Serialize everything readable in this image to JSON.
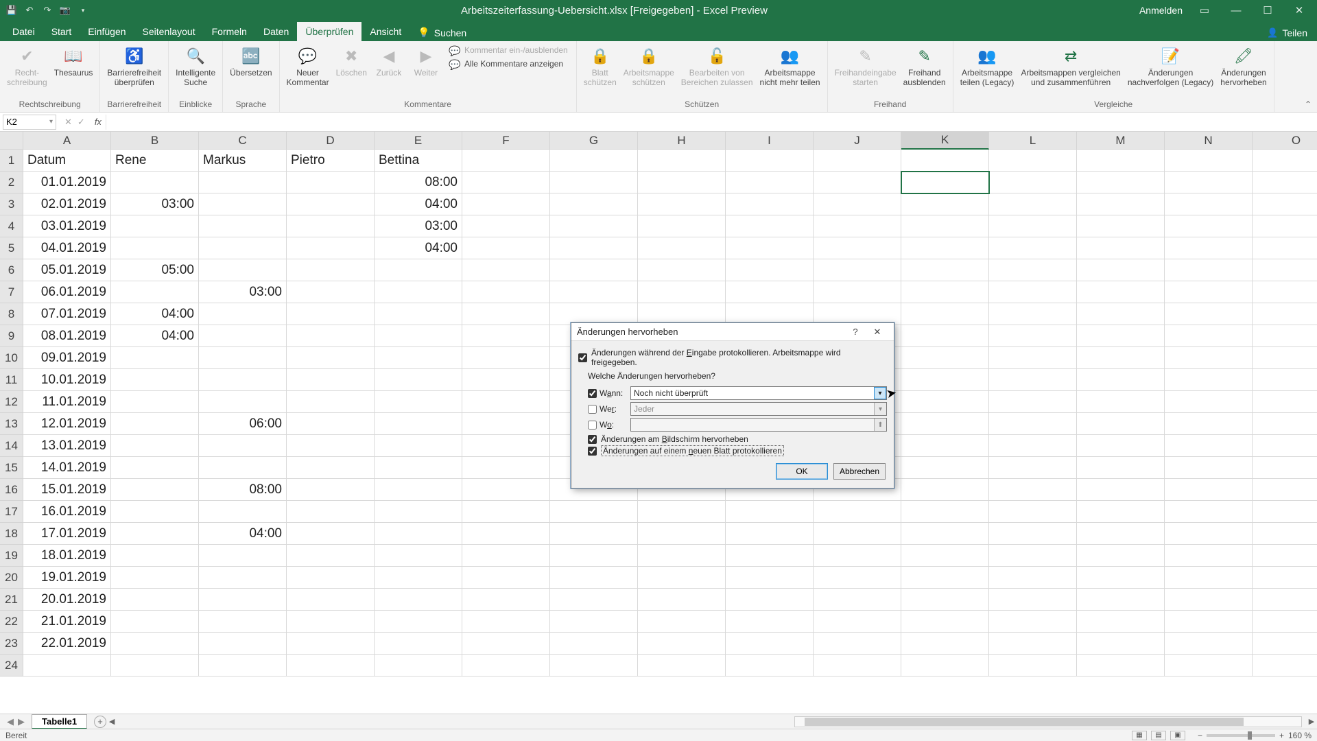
{
  "titlebar": {
    "doc_title": "Arbeitszeiterfassung-Uebersicht.xlsx  [Freigegeben] - Excel Preview",
    "sign_in": "Anmelden"
  },
  "tabs": {
    "items": [
      "Datei",
      "Start",
      "Einfügen",
      "Seitenlayout",
      "Formeln",
      "Daten",
      "Überprüfen",
      "Ansicht"
    ],
    "active_index": 6,
    "search": "Suchen",
    "share": "Teilen"
  },
  "ribbon": {
    "groups": [
      {
        "label": "Rechtschreibung",
        "items": [
          {
            "name": "rechtschreibung",
            "text": "Recht-\nschreibung",
            "icon": "✔",
            "disabled": true
          },
          {
            "name": "thesaurus",
            "text": "Thesaurus",
            "icon": "📖"
          }
        ]
      },
      {
        "label": "Barrierefreiheit",
        "items": [
          {
            "name": "barrierefreiheit",
            "text": "Barrierefreiheit\nüberprüfen",
            "icon": "♿"
          }
        ]
      },
      {
        "label": "Einblicke",
        "items": [
          {
            "name": "intelligente-suche",
            "text": "Intelligente\nSuche",
            "icon": "🔍"
          }
        ]
      },
      {
        "label": "Sprache",
        "items": [
          {
            "name": "uebersetzen",
            "text": "Übersetzen",
            "icon": "🔤"
          }
        ]
      },
      {
        "label": "Kommentare",
        "items": [
          {
            "name": "neuer-kommentar",
            "text": "Neuer\nKommentar",
            "icon": "💬"
          },
          {
            "name": "loeschen",
            "text": "Löschen",
            "icon": "✖",
            "disabled": true
          },
          {
            "name": "zurueck",
            "text": "Zurück",
            "icon": "◀",
            "disabled": true
          },
          {
            "name": "weiter",
            "text": "Weiter",
            "icon": "▶",
            "disabled": true
          }
        ],
        "stack": [
          {
            "name": "kommentar-ein-aus",
            "text": "Kommentar ein-/ausblenden",
            "icon": "💬",
            "disabled": true
          },
          {
            "name": "alle-kommentare",
            "text": "Alle Kommentare anzeigen",
            "icon": "💬"
          }
        ]
      },
      {
        "label": "Schützen",
        "items": [
          {
            "name": "blatt-schuetzen",
            "text": "Blatt\nschützen",
            "icon": "🔒",
            "disabled": true
          },
          {
            "name": "mappe-schuetzen",
            "text": "Arbeitsmappe\nschützen",
            "icon": "🔒",
            "disabled": true
          },
          {
            "name": "bearbeiten-bereiche",
            "text": "Bearbeiten von\nBereichen zulassen",
            "icon": "🔓",
            "disabled": true
          },
          {
            "name": "mappe-nicht-teilen",
            "text": "Arbeitsmappe\nnicht mehr teilen",
            "icon": "👥"
          }
        ]
      },
      {
        "label": "Freihand",
        "items": [
          {
            "name": "freihand-start",
            "text": "Freihandeingabe\nstarten",
            "icon": "✎",
            "disabled": true
          },
          {
            "name": "freihand-ausblenden",
            "text": "Freihand\nausblenden",
            "icon": "✎"
          }
        ]
      },
      {
        "label": "Vergleiche",
        "items": [
          {
            "name": "mappe-teilen",
            "text": "Arbeitsmappe\nteilen (Legacy)",
            "icon": "👥"
          },
          {
            "name": "mappen-vergleichen",
            "text": "Arbeitsmappen vergleichen\nund zusammenführen",
            "icon": "⇄"
          },
          {
            "name": "aenderungen-nachverfolgen",
            "text": "Änderungen\nnachverfolgen (Legacy)",
            "icon": "📝"
          },
          {
            "name": "aenderungen-hervorheben",
            "text": "Änderungen\nhervorheben",
            "icon": "🖍"
          }
        ]
      }
    ]
  },
  "namebox": "K2",
  "columns": [
    "A",
    "B",
    "C",
    "D",
    "E",
    "F",
    "G",
    "H",
    "I",
    "J",
    "K",
    "L",
    "M",
    "N",
    "O"
  ],
  "selected_col": "K",
  "selected_row": 2,
  "rows": [
    {
      "n": 1,
      "cells": [
        "Datum",
        "Rene",
        "Markus",
        "Pietro",
        "Bettina",
        "",
        "",
        "",
        "",
        "",
        "",
        "",
        "",
        ""
      ],
      "align": [
        "lt",
        "lt",
        "lt",
        "lt",
        "lt"
      ]
    },
    {
      "n": 2,
      "cells": [
        "01.01.2019",
        "",
        "",
        "",
        "08:00",
        "",
        "",
        "",
        "",
        "",
        "",
        "",
        "",
        ""
      ]
    },
    {
      "n": 3,
      "cells": [
        "02.01.2019",
        "03:00",
        "",
        "",
        "04:00",
        "",
        "",
        "",
        "",
        "",
        "",
        "",
        "",
        ""
      ]
    },
    {
      "n": 4,
      "cells": [
        "03.01.2019",
        "",
        "",
        "",
        "03:00",
        "",
        "",
        "",
        "",
        "",
        "",
        "",
        "",
        ""
      ]
    },
    {
      "n": 5,
      "cells": [
        "04.01.2019",
        "",
        "",
        "",
        "04:00",
        "",
        "",
        "",
        "",
        "",
        "",
        "",
        "",
        ""
      ]
    },
    {
      "n": 6,
      "cells": [
        "05.01.2019",
        "05:00",
        "",
        "",
        "",
        "",
        "",
        "",
        "",
        "",
        "",
        "",
        "",
        ""
      ]
    },
    {
      "n": 7,
      "cells": [
        "06.01.2019",
        "",
        "03:00",
        "",
        "",
        "",
        "",
        "",
        "",
        "",
        "",
        "",
        "",
        ""
      ]
    },
    {
      "n": 8,
      "cells": [
        "07.01.2019",
        "04:00",
        "",
        "",
        "",
        "",
        "",
        "",
        "",
        "",
        "",
        "",
        "",
        ""
      ]
    },
    {
      "n": 9,
      "cells": [
        "08.01.2019",
        "04:00",
        "",
        "",
        "",
        "",
        "",
        "",
        "",
        "",
        "",
        "",
        "",
        ""
      ]
    },
    {
      "n": 10,
      "cells": [
        "09.01.2019",
        "",
        "",
        "",
        "",
        "",
        "",
        "",
        "",
        "",
        "",
        "",
        "",
        ""
      ]
    },
    {
      "n": 11,
      "cells": [
        "10.01.2019",
        "",
        "",
        "",
        "",
        "",
        "",
        "",
        "",
        "",
        "",
        "",
        "",
        ""
      ]
    },
    {
      "n": 12,
      "cells": [
        "11.01.2019",
        "",
        "",
        "",
        "",
        "",
        "",
        "",
        "",
        "",
        "",
        "",
        "",
        ""
      ]
    },
    {
      "n": 13,
      "cells": [
        "12.01.2019",
        "",
        "06:00",
        "",
        "",
        "",
        "",
        "",
        "",
        "",
        "",
        "",
        "",
        ""
      ]
    },
    {
      "n": 14,
      "cells": [
        "13.01.2019",
        "",
        "",
        "",
        "",
        "",
        "",
        "",
        "",
        "",
        "",
        "",
        "",
        ""
      ]
    },
    {
      "n": 15,
      "cells": [
        "14.01.2019",
        "",
        "",
        "",
        "",
        "",
        "",
        "",
        "",
        "",
        "",
        "",
        "",
        ""
      ]
    },
    {
      "n": 16,
      "cells": [
        "15.01.2019",
        "",
        "08:00",
        "",
        "",
        "",
        "",
        "",
        "",
        "",
        "",
        "",
        "",
        ""
      ]
    },
    {
      "n": 17,
      "cells": [
        "16.01.2019",
        "",
        "",
        "",
        "",
        "",
        "",
        "",
        "",
        "",
        "",
        "",
        "",
        ""
      ]
    },
    {
      "n": 18,
      "cells": [
        "17.01.2019",
        "",
        "04:00",
        "",
        "",
        "",
        "",
        "",
        "",
        "",
        "",
        "",
        "",
        ""
      ]
    },
    {
      "n": 19,
      "cells": [
        "18.01.2019",
        "",
        "",
        "",
        "",
        "",
        "",
        "",
        "",
        "",
        "",
        "",
        "",
        ""
      ]
    },
    {
      "n": 20,
      "cells": [
        "19.01.2019",
        "",
        "",
        "",
        "",
        "",
        "",
        "",
        "",
        "",
        "",
        "",
        "",
        ""
      ]
    },
    {
      "n": 21,
      "cells": [
        "20.01.2019",
        "",
        "",
        "",
        "",
        "",
        "",
        "",
        "",
        "",
        "",
        "",
        "",
        ""
      ]
    },
    {
      "n": 22,
      "cells": [
        "21.01.2019",
        "",
        "",
        "",
        "",
        "",
        "",
        "",
        "",
        "",
        "",
        "",
        "",
        ""
      ]
    },
    {
      "n": 23,
      "cells": [
        "22.01.2019",
        "",
        "",
        "",
        "",
        "",
        "",
        "",
        "",
        "",
        "",
        "",
        "",
        ""
      ]
    },
    {
      "n": 24,
      "cells": [
        "",
        "",
        "",
        "",
        "",
        "",
        "",
        "",
        "",
        "",
        "",
        "",
        "",
        ""
      ]
    }
  ],
  "dialog": {
    "title": "Änderungen hervorheben",
    "track_label_pre": "Änderungen während der ",
    "track_label_u": "E",
    "track_label_post": "ingabe protokollieren. Arbeitsmappe wird freigegeben.",
    "question": "Welche Änderungen hervorheben?",
    "wann_u": "a",
    "wann_label_pre": "W",
    "wann_label_post": "nn:",
    "wer_u": "r",
    "wer_label_pre": "We",
    "wer_label_post": ":",
    "wo_u": "o",
    "wo_label_pre": "W",
    "wo_label_post": ":",
    "wann_value": "Noch nicht überprüft",
    "wer_value": "Jeder",
    "wo_value": "",
    "chk_screen_pre": "Änderungen am ",
    "chk_screen_u": "B",
    "chk_screen_post": "ildschirm hervorheben",
    "chk_sheet_pre": "Änderungen auf einem ",
    "chk_sheet_u": "n",
    "chk_sheet_post": "euen Blatt protokollieren",
    "ok": "OK",
    "cancel": "Abbrechen"
  },
  "sheettab": "Tabelle1",
  "status": "Bereit",
  "zoom": "160 %"
}
